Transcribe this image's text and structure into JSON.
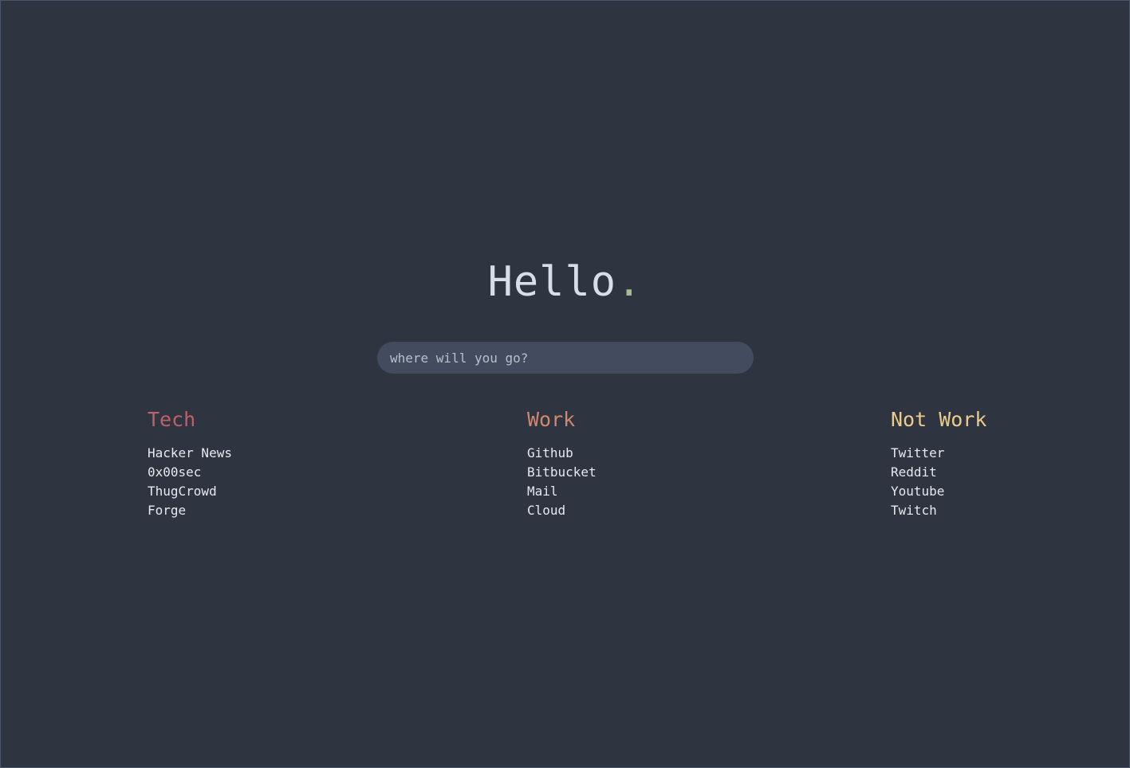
{
  "greeting": {
    "text": "Hello",
    "punctuation": ".",
    "text_color": "#d8dee9",
    "accent_color": "#a3be8c"
  },
  "search": {
    "placeholder": "where will you go?",
    "value": ""
  },
  "categories": [
    {
      "title": "Tech",
      "color": "#bf616a",
      "links": [
        "Hacker News",
        "0x00sec",
        "ThugCrowd",
        "Forge"
      ]
    },
    {
      "title": "Work",
      "color": "#d08770",
      "links": [
        "Github",
        "Bitbucket",
        "Mail",
        "Cloud"
      ]
    },
    {
      "title": "Not Work",
      "color": "#ebcb8b",
      "links": [
        "Twitter",
        "Reddit",
        "Youtube",
        "Twitch"
      ]
    }
  ],
  "theme": {
    "background": "#2e3440",
    "search_background": "#434c5e",
    "link_color": "#e5e9f0"
  }
}
